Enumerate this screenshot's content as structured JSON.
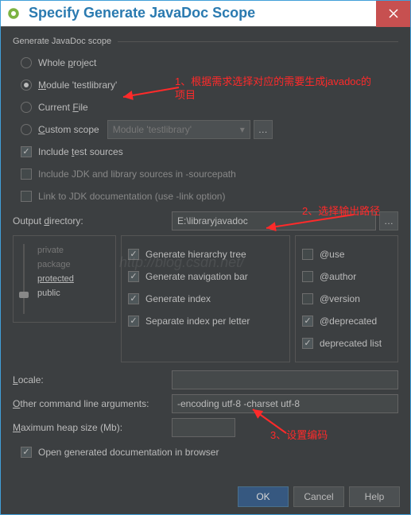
{
  "titlebar": {
    "title": "Specify Generate JavaDoc Scope"
  },
  "fieldset": "Generate JavaDoc scope",
  "radios": {
    "whole": "Whole project",
    "module": "Module 'testlibrary'",
    "current": "Current File",
    "custom": "Custom scope"
  },
  "customDropdown": "Module 'testlibrary'",
  "checks": {
    "includeTests": "Include test sources",
    "includeJdk": "Include JDK and library sources in -sourcepath",
    "linkJdk": "Link to JDK documentation (use -link option)",
    "openBrowser": "Open generated documentation in browser"
  },
  "outputLabel": "Output directory:",
  "outputValue": "E:\\libraryjavadoc",
  "visibility": {
    "private": "private",
    "package": "package",
    "protected": "protected",
    "public": "public"
  },
  "genOptions": {
    "hierarchy": "Generate hierarchy tree",
    "navbar": "Generate navigation bar",
    "index": "Generate index",
    "sepIndex": "Separate index per letter"
  },
  "tagOptions": {
    "use": "@use",
    "author": "@author",
    "version": "@version",
    "deprecated": "@deprecated",
    "deplist": "deprecated list"
  },
  "localeLabel": "Locale:",
  "localeValue": "",
  "argsLabel": "Other command line arguments:",
  "argsValue": "-encoding utf-8 -charset utf-8",
  "heapLabel": "Maximum heap size (Mb):",
  "heapValue": "",
  "buttons": {
    "ok": "OK",
    "cancel": "Cancel",
    "help": "Help"
  },
  "annotations": {
    "a1": "1、根据需求选择对应的需要生成javadoc的项目",
    "a2": "2、选择输出路径",
    "a3": "3、设置编码"
  },
  "watermark": "http://blog.csdn.net/"
}
